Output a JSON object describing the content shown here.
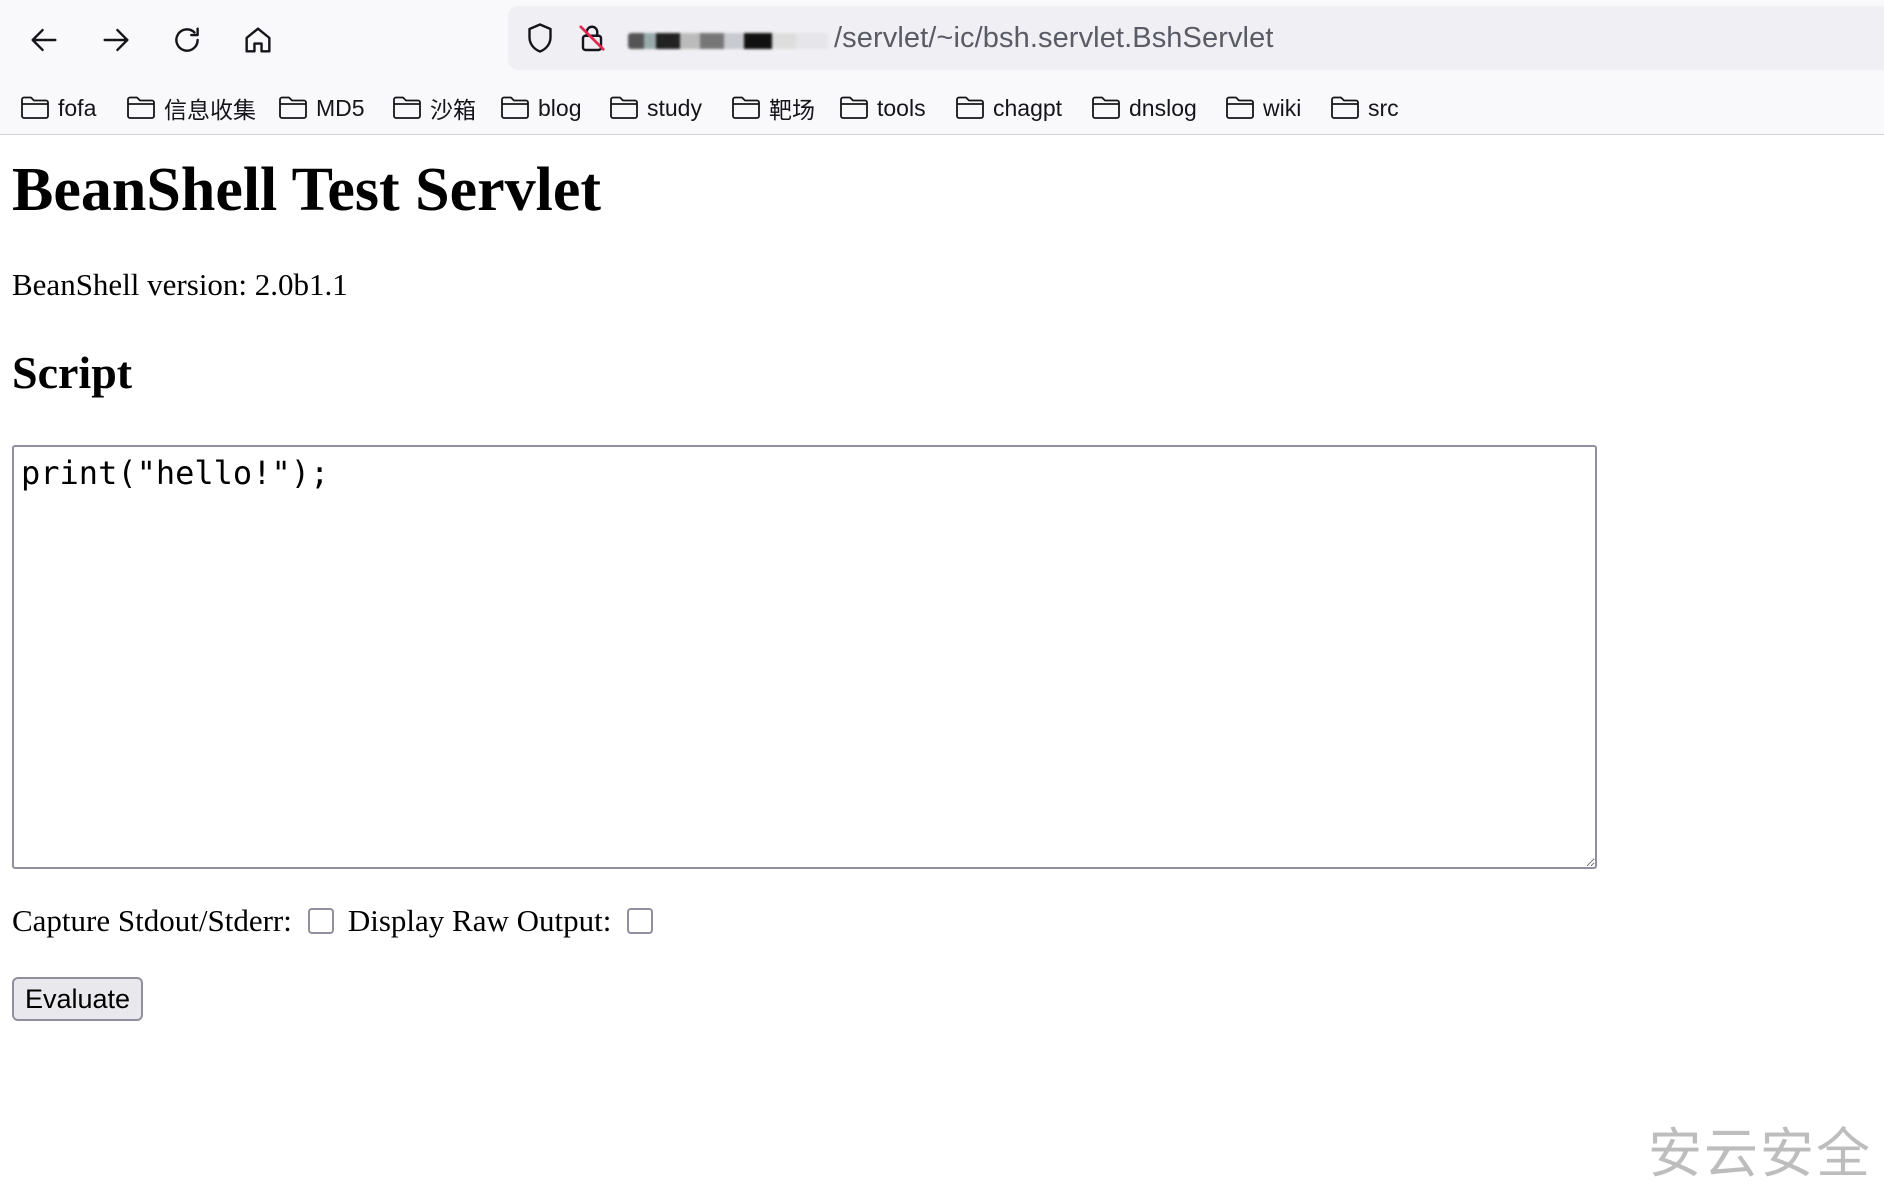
{
  "browser": {
    "url_visible": "/servlet/~ic/bsh.servlet.BshServlet",
    "bookmarks": [
      {
        "label": "fofa"
      },
      {
        "label": "信息收集"
      },
      {
        "label": "MD5"
      },
      {
        "label": "沙箱"
      },
      {
        "label": "blog"
      },
      {
        "label": "study"
      },
      {
        "label": "靶场"
      },
      {
        "label": "tools"
      },
      {
        "label": "chagpt"
      },
      {
        "label": "dnslog"
      },
      {
        "label": "wiki"
      },
      {
        "label": "src"
      }
    ],
    "icons": {
      "back": "back-arrow-icon",
      "forward": "forward-arrow-icon",
      "reload": "reload-icon",
      "home": "home-icon",
      "tracking": "shield-icon",
      "security": "insecure-lock-icon",
      "bookmark": "folder-icon"
    }
  },
  "page": {
    "title": "BeanShell Test Servlet",
    "version_text": "BeanShell version: 2.0b1.1",
    "section_title": "Script",
    "script_value": "print(\"hello!\");",
    "capture_label": "Capture Stdout/Stderr:",
    "raw_output_label": "Display Raw Output:",
    "evaluate_label": "Evaluate"
  },
  "watermark": "安云安全",
  "colors": {
    "chrome_bg": "#f9f9fb",
    "urlbar_bg": "#f0f0f4",
    "url_text": "#5b5b66",
    "insecure_slash": "#e22850",
    "watermark": "#bdbdbd"
  }
}
